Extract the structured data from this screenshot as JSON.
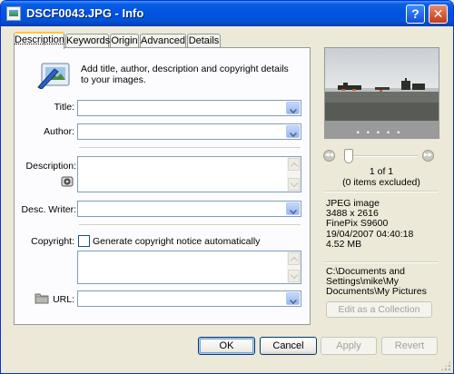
{
  "window": {
    "title": "DSCF0043.JPG - Info",
    "help_glyph": "?",
    "close_glyph": "✕"
  },
  "tabs": [
    {
      "label": "Description",
      "active": true
    },
    {
      "label": "Keywords",
      "active": false
    },
    {
      "label": "Origin",
      "active": false
    },
    {
      "label": "Advanced",
      "active": false
    },
    {
      "label": "Details",
      "active": false
    }
  ],
  "description_tab": {
    "header_text": "Add title, author, description and copyright details to your images.",
    "title_label": "Title:",
    "title_value": "",
    "author_label": "Author:",
    "author_value": "",
    "description_label": "Description:",
    "description_value": "",
    "desc_writer_label": "Desc. Writer:",
    "desc_writer_value": "",
    "copyright_label": "Copyright:",
    "copyright_checkbox_label": "Generate copyright notice automatically",
    "copyright_checked": false,
    "copyright_value": "",
    "url_label": "URL:",
    "url_value": ""
  },
  "preview": {
    "counter": "1 of 1",
    "excluded": "(0 items excluded)"
  },
  "file_info": {
    "type": "JPEG image",
    "dimensions": "3488 x 2616",
    "camera": "FinePix S9600",
    "datetime": "19/04/2007 04:40:18",
    "size": "4.52 MB"
  },
  "path": {
    "line1": "C:\\Documents and",
    "line2": "Settings\\mike\\My",
    "line3": "Documents\\My Pictures"
  },
  "collection_button": "Edit as a Collection",
  "buttons": {
    "ok": "OK",
    "cancel": "Cancel",
    "apply": "Apply",
    "revert": "Revert"
  },
  "colors": {
    "titlebar": "#0054e3",
    "dialog_bg": "#ece9d8",
    "active_tab_accent": "#ffc83c",
    "field_border": "#7f9db9"
  }
}
